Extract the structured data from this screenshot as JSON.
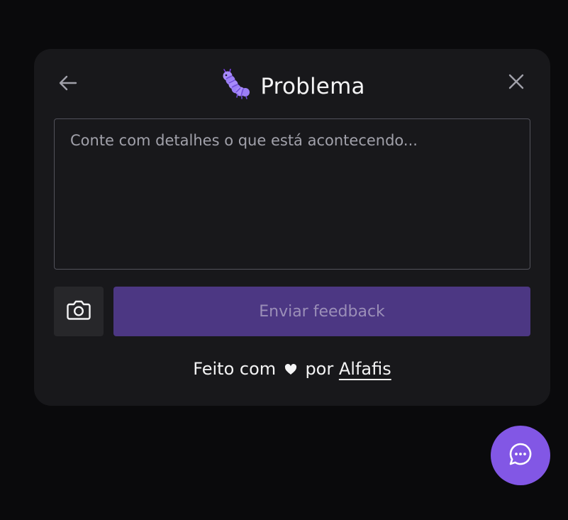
{
  "widget": {
    "title": "Problema",
    "title_icon": "caterpillar-emoji-icon",
    "back_icon": "arrow-left-icon",
    "close_icon": "close-icon",
    "textarea": {
      "placeholder": "Conte com detalhes o que está acontecendo...",
      "value": ""
    },
    "screenshot_icon": "camera-icon",
    "submit_label": "Enviar feedback",
    "credit": {
      "prefix": "Feito com",
      "heart_icon": "heart-icon",
      "middle": "por",
      "link_label": "Alfafis"
    }
  },
  "fab": {
    "icon": "chat-bubble-icon"
  },
  "colors": {
    "background": "#0a0a0c",
    "panel": "#18181b",
    "brand": "#8257e5",
    "submit_disabled": "#4c3783",
    "border": "#52525b"
  }
}
